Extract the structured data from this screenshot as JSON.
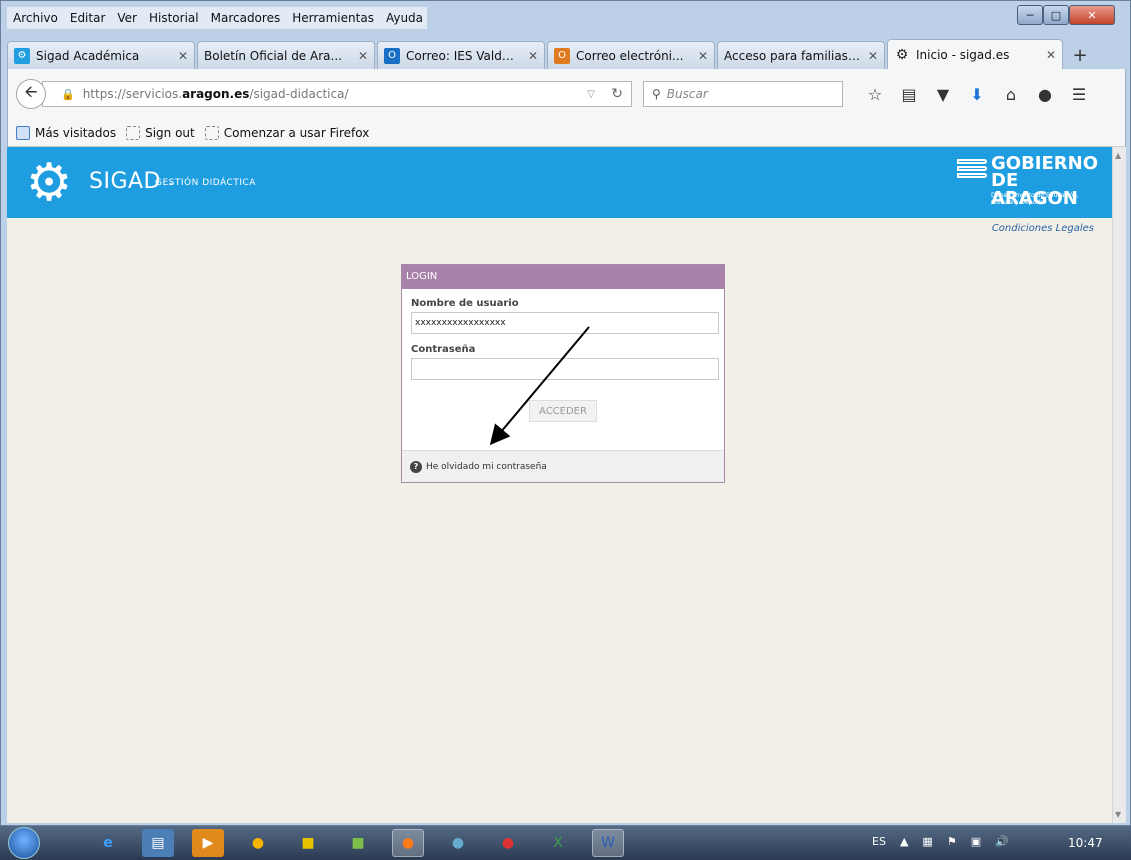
{
  "menubar": [
    "Archivo",
    "Editar",
    "Ver",
    "Historial",
    "Marcadores",
    "Herramientas",
    "Ayuda"
  ],
  "tabs": [
    {
      "label": "Sigad Académica",
      "icon": "gear-icon",
      "color": "#1e9ee0"
    },
    {
      "label": "Boletín Oficial de Ara...",
      "icon": "",
      "color": ""
    },
    {
      "label": "Correo: IES Valde...",
      "icon": "outlook-icon",
      "color": "#1a6fc4"
    },
    {
      "label": "Correo electróni...",
      "icon": "mail-icon",
      "color": "#e07a1e"
    },
    {
      "label": "Acceso para familias ...",
      "icon": "",
      "color": ""
    },
    {
      "label": "Inicio - sigad.es",
      "icon": "gear-icon",
      "color": "#222222"
    }
  ],
  "url": {
    "prefix": "https://servicios.",
    "host": "aragon.es",
    "path": "/sigad-didactica/"
  },
  "search": {
    "placeholder": "Buscar"
  },
  "bookmarks": [
    "Más visitados",
    "Sign out",
    "Comenzar a usar Firefox"
  ],
  "header": {
    "brand": "SIGAD",
    "sep": "-",
    "sub": "GESTIÓN DIDÁCTICA",
    "gov1": "GOBIERNO",
    "gov2": "DE ARAGON",
    "gov3": "Departamento de Educación, Cultura y Deporte",
    "color": "#1e9ee0"
  },
  "legal": "Condiciones Legales",
  "login": {
    "title": "LOGIN",
    "user_label": "Nombre de usuario",
    "user_value": "xxxxxxxxxxxxxxxxx",
    "pass_label": "Contraseña",
    "submit": "ACCEDER",
    "forgot": "He olvidado mi contraseña",
    "accent": "#a882a9"
  },
  "taskbar": {
    "lang": "ES",
    "clock": "10:47"
  }
}
